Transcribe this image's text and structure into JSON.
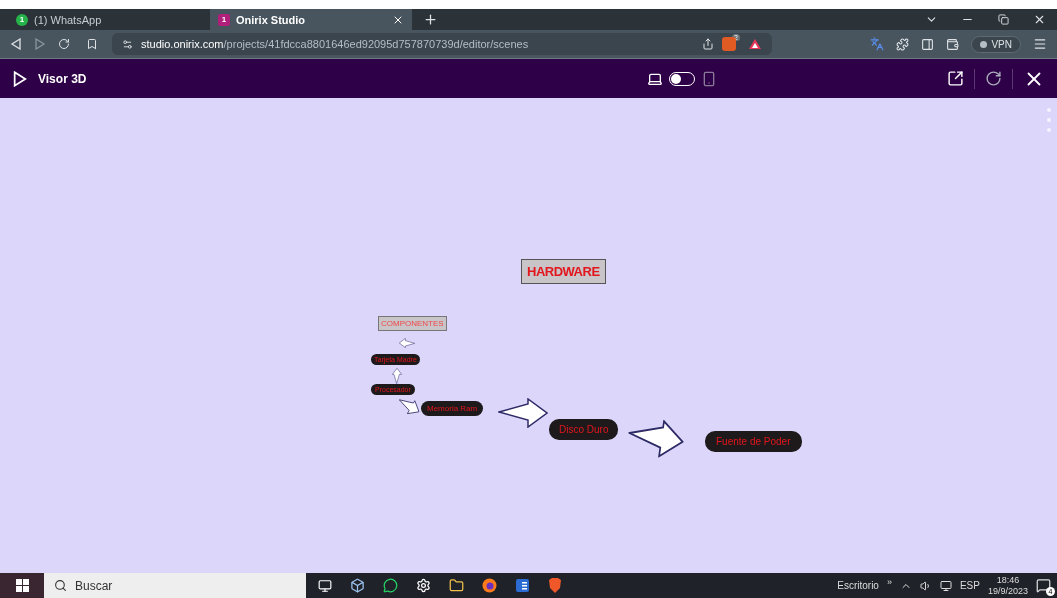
{
  "browser": {
    "tabs": [
      {
        "title": "(1) WhatsApp",
        "badge": "1",
        "selected": false
      },
      {
        "title": "Onirix Studio",
        "badge": "1",
        "selected": true
      }
    ],
    "address": {
      "host": "studio.onirix.com",
      "path": "/projects/41fdcca8801646ed92095d757870739d/editor/scenes"
    },
    "shield_badge": "2",
    "vpn": "VPN"
  },
  "viewer": {
    "title": "Visor 3D",
    "mobile_preview": false
  },
  "scene": {
    "nodes": [
      {
        "kind": "title",
        "text": "HARDWARE"
      },
      {
        "kind": "label",
        "text": "COMPONENTES"
      },
      {
        "kind": "pill",
        "text": "Tarjeta Madre"
      },
      {
        "kind": "pill",
        "text": "Procesador"
      },
      {
        "kind": "pill",
        "text": "Memoria Ram"
      },
      {
        "kind": "pill",
        "text": "Disco Duro"
      },
      {
        "kind": "pill",
        "text": "Fuente de Poder"
      }
    ]
  },
  "taskbar": {
    "search_placeholder": "Buscar",
    "desktop": "Escritorio",
    "chevron": "»",
    "language": "ESP",
    "time": "18:46",
    "date": "19/9/2023",
    "notifications": "4"
  }
}
